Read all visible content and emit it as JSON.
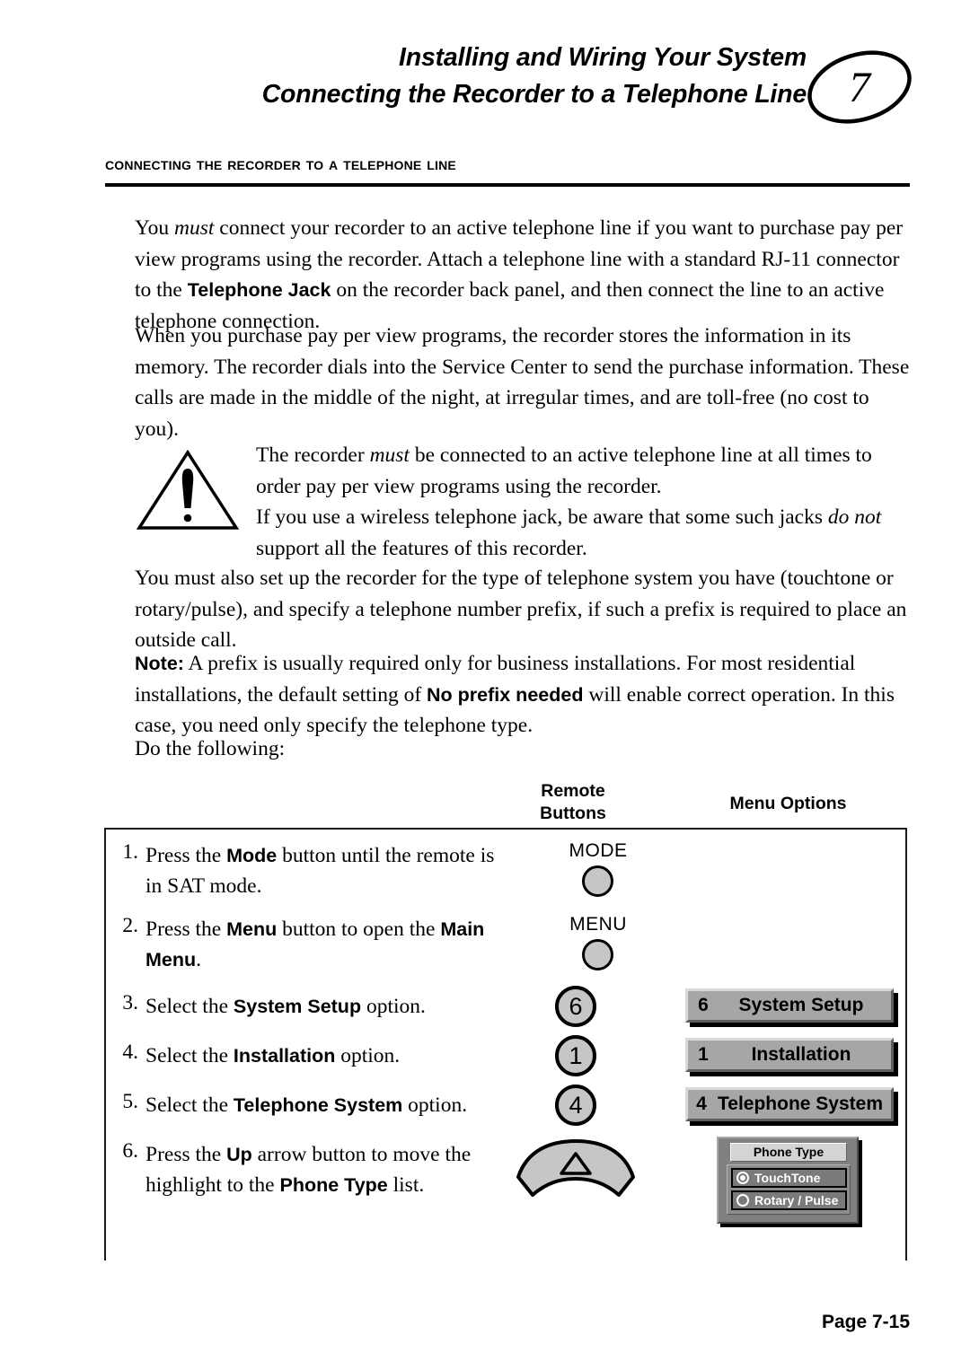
{
  "header": {
    "title_line1": "Installing and Wiring Your System",
    "title_line2": "Connecting the Recorder to a Telephone Line",
    "chapter_number": "7"
  },
  "section": {
    "heading": "Connecting the Recorder to a Telephone Line"
  },
  "paragraphs": {
    "p1_a": "You ",
    "p1_b": "must",
    "p1_c": " connect your recorder to an active telephone line if you want to purchase pay per view programs using the recorder.  Attach a telephone line with a standard RJ-11 connector to the ",
    "p1_d": "Telephone Jack",
    "p1_e": " on the recorder back panel, and then connect the line to an active telephone connection.",
    "p2": "When you purchase pay per view programs, the recorder stores the information in its memory.  The recorder dials into the Service Center to send the purchase information.  These calls are made in the middle of the night, at irregular times, and are toll-free (no cost to you).",
    "p4": "You must also set up the recorder for the type of telephone system you have (touchtone or rotary/pulse), and specify a telephone number prefix, if such a prefix is required to place an outside call.",
    "note_label": "Note:",
    "note_a": "  A prefix is usually required only for business installations.  For most residential installations, the default setting of ",
    "note_b": "No prefix needed",
    "note_c": " will enable correct operation.  In this case, you need only specify the telephone type.",
    "p6": "Do the following:"
  },
  "warning": {
    "line1_a": "The recorder ",
    "line1_b": "must",
    "line1_c": " be connected to an active telephone line at all times to order pay per view programs using the recorder.",
    "line2_a": "If you use a wireless telephone jack, be aware that some such jacks ",
    "line2_b": "do not",
    "line2_c": " support all the features of this recorder."
  },
  "table": {
    "col_header_remote": "Remote\nButtons",
    "col_header_remote_line1": "Remote",
    "col_header_remote_line2": "Buttons",
    "col_header_menu": "Menu Options",
    "steps": [
      {
        "num": "1.",
        "text_a": "Press the ",
        "text_b": "Mode",
        "text_c": " button until the remote is in SAT mode.",
        "button_label": "MODE"
      },
      {
        "num": "2.",
        "text_a": "Press the ",
        "text_b": "Menu",
        "text_c": " button to open the ",
        "text_d": "Main Menu",
        "text_e": ".",
        "button_label": "MENU"
      },
      {
        "num": "3.",
        "text_a": "Select the ",
        "text_b": "System Setup",
        "text_c": " option.",
        "button_digit": "6",
        "menu_num": "6",
        "menu_label": "System Setup"
      },
      {
        "num": "4.",
        "text_a": "Select the ",
        "text_b": "Installation",
        "text_c": " option.",
        "button_digit": "1",
        "menu_num": "1",
        "menu_label": "Installation"
      },
      {
        "num": "5.",
        "text_a": "Select the ",
        "text_b": "Telephone System",
        "text_c": " option.",
        "button_digit": "4",
        "menu_num": "4",
        "menu_label": "Telephone System"
      },
      {
        "num": "6.",
        "text_a": "Press the ",
        "text_b": "Up",
        "text_c": " arrow button to move the highlight to the ",
        "text_d": "Phone Type",
        "text_e": " list."
      }
    ]
  },
  "phone_dialog": {
    "title": "Phone Type",
    "options": [
      {
        "label": "TouchTone",
        "selected": true
      },
      {
        "label": "Rotary / Pulse",
        "selected": false
      }
    ]
  },
  "footer": {
    "page": "Page 7-15"
  },
  "colors": {
    "button_gray": "#c6c6c6",
    "menu_bar_gray": "#a6a6a6",
    "dialog_gray": "#808080",
    "dialog_title_gray": "#d4d4d4",
    "dialog_item_gray": "#7a7a7a"
  }
}
